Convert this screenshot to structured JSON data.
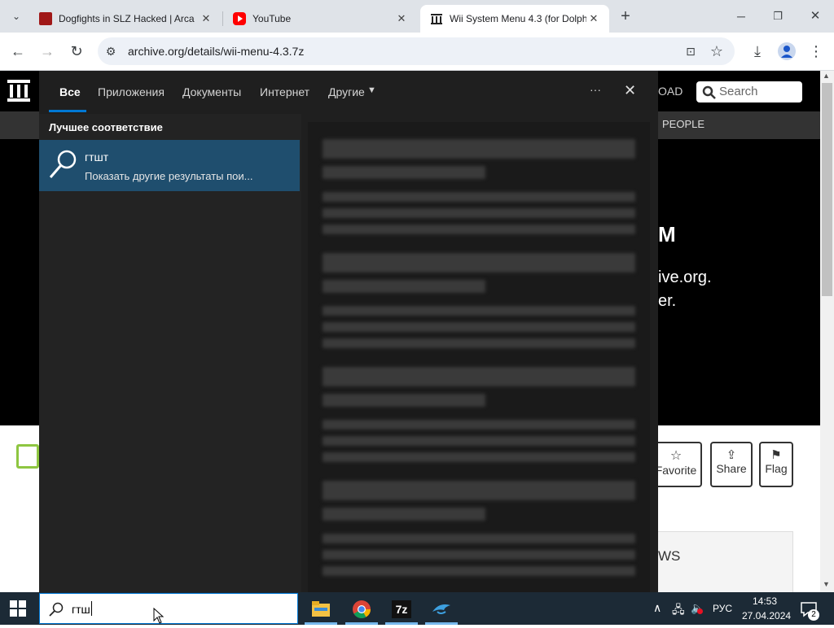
{
  "browser": {
    "tabs": [
      {
        "title": "Dogfights in SLZ Hacked | Arca",
        "close": "✕",
        "favicon": "arcade-icon"
      },
      {
        "title": "YouTube",
        "close": "✕",
        "favicon": "youtube-icon"
      },
      {
        "title": "Wii System Menu 4.3 (for Dolph",
        "close": "✕",
        "favicon": "archive-icon",
        "active": true
      }
    ],
    "new_tab": "+",
    "url": "archive.org/details/wii-menu-4.3.7z"
  },
  "page": {
    "nav_right": "OAD",
    "search_placeholder": "Search",
    "people": "PEOPLE",
    "hero_letter": "M",
    "hero_line1": "ive.org.",
    "hero_line2": "er.",
    "buttons": {
      "favorite": "Favorite",
      "share": "Share",
      "flag": "Flag"
    },
    "reviews": "WS"
  },
  "search": {
    "tabs": [
      "Все",
      "Приложения",
      "Документы",
      "Интернет",
      "Другие"
    ],
    "more": "···",
    "close": "✕",
    "best_match_header": "Лучшее соответствие",
    "result_title": "гтшт",
    "result_subtitle": "Показать другие результаты пои...",
    "query": "гтш"
  },
  "taskbar": {
    "lang": "РУС",
    "time": "14:53",
    "date": "27.04.2024",
    "notifications": "2",
    "apps": [
      "file-explorer-icon",
      "chrome-icon",
      "7zip-icon",
      "dolphin-icon"
    ]
  },
  "colors": {
    "accent": "#0078d4",
    "result_bg": "#1f4e6e",
    "taskbar": "#1c2a36"
  }
}
